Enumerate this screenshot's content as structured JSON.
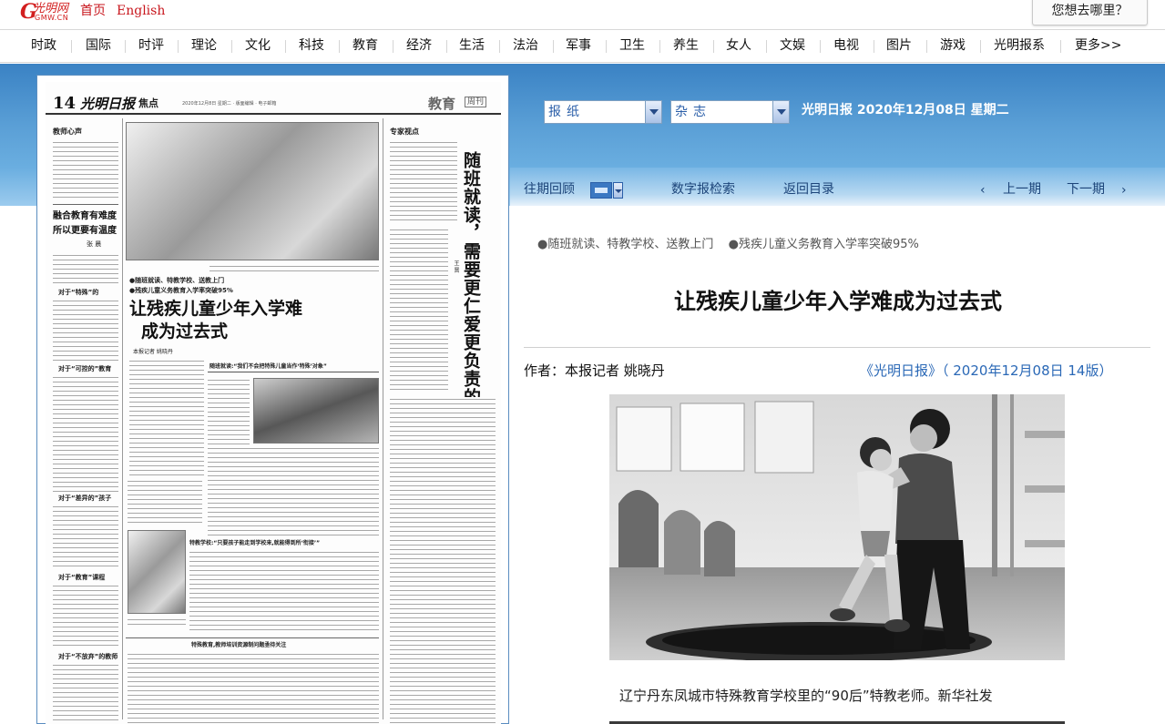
{
  "site": {
    "logo_text": "光明网",
    "logo_sub": "GMW.CN",
    "home": "首页",
    "english": "English",
    "where_button": "您想去哪里？"
  },
  "nav": [
    "时政",
    "国际",
    "时评",
    "理论",
    "文化",
    "科技",
    "教育",
    "经济",
    "生活",
    "法治",
    "军事",
    "卫生",
    "养生",
    "女人",
    "文娱",
    "电视",
    "图片",
    "游戏",
    "光明报系",
    "更多>>"
  ],
  "toolbar": {
    "newspaper_select": "报纸",
    "magazine_select": "杂志",
    "date_line": "光明日报  2020年12月08日  星期二",
    "past_issues": "往期回顾",
    "digital_search": "数字报检索",
    "back_to_index": "返回目录",
    "prev_page": "上一期",
    "next_page": "下一期"
  },
  "newspaper_page": {
    "page_number": "14",
    "masthead": "光明日报",
    "section": "焦点",
    "meta": "2020年12月8日 星期二 · 版面编辑 · 电子邮箱",
    "edu": "教育",
    "week": "周刊",
    "col_head_left": "教师心声",
    "left_title_1": "融合教育有难度",
    "left_title_2": "所以更要有温度",
    "left_author": "张 晨",
    "left_sub_1": "对于“特殊”的",
    "left_sub_2": "对于“可控的”教育",
    "left_sub_3": "对于“差异的”孩子",
    "left_sub_4": "对于“教育”课程",
    "left_sub_5": "对于“不放弃”的教师",
    "mid_kicker_1": "●随班就读、特教学校、送教上门",
    "mid_kicker_2": "●残疾儿童义务教育入学率突破95%",
    "mid_title_1": "让残疾儿童少年入学难",
    "mid_title_2": "成为过去式",
    "mid_author": "本报记者  姚晓丹",
    "sub_head_1": "随班就读:“我们不会把特殊儿童当作‘特殊’对象”",
    "sub_head_2": "特教学校:“只要孩子能走到学校来,就能得到所‘衔接’”",
    "sub_head_3": "特殊教育,教师培训资源制问题亟待关注",
    "col_head_right": "专家视点",
    "vertical_title": "随班就读，需要更仁爱更负责的好老师",
    "vertical_author": "王 晋"
  },
  "article": {
    "breadcrumb_1": "●随班就读、特教学校、送教上门",
    "breadcrumb_2": "●残疾儿童义务教育入学率突破95%",
    "title": "让残疾儿童少年入学难成为过去式",
    "author": "作者：本报记者 姚晓丹",
    "source": "《光明日报》（ 2020年12月08日  14版）",
    "caption": "辽宁丹东凤城市特殊教育学校里的“90后”特教老师。新华社发"
  }
}
